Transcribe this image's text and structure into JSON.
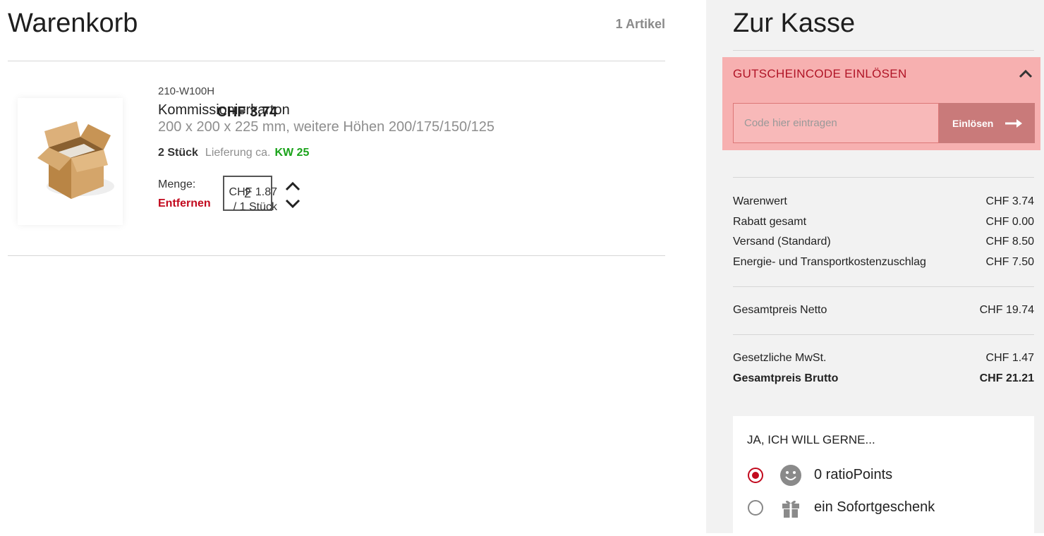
{
  "cart": {
    "title": "Warenkorb",
    "item_count": "1 Artikel",
    "item": {
      "sku": "210-W100H",
      "name": "Kommissionierkarton",
      "dimensions": "200 x 200 x 225 mm, weitere Höhen 200/175/150/125",
      "quantity_text": "2 Stück",
      "delivery_label": "Lieferung ca.",
      "delivery_week": "KW 25",
      "price": "CHF 3.74",
      "quantity_label": "Menge:",
      "remove_label": "Entfernen",
      "quantity_value": "2",
      "unit_price": "CHF 1.87",
      "unit_per": "/ 1 Stück"
    }
  },
  "checkout": {
    "title": "Zur Kasse",
    "coupon": {
      "title": "GUTSCHEINCODE EINLÖSEN",
      "placeholder": "Code hier eintragen",
      "button_label": "Einlösen"
    },
    "summary": [
      {
        "label": "Warenwert",
        "value": "CHF 3.74"
      },
      {
        "label": "Rabatt gesamt",
        "value": "CHF 0.00"
      },
      {
        "label": "Versand (Standard)",
        "value": "CHF 8.50"
      },
      {
        "label": "Energie- und Transportkostenzuschlag",
        "value": "CHF 7.50"
      }
    ],
    "net": {
      "label": "Gesamtpreis Netto",
      "value": "CHF 19.74"
    },
    "vat": {
      "label": "Gesetzliche MwSt.",
      "value": "CHF 1.47"
    },
    "gross": {
      "label": "Gesamtpreis Brutto",
      "value": "CHF 21.21"
    },
    "bonus": {
      "title": "JA, ICH WILL GERNE...",
      "options": [
        {
          "label": "0 ratioPoints",
          "icon": "smiley-icon",
          "selected": true
        },
        {
          "label": "ein Sofortgeschenk",
          "icon": "gift-icon",
          "selected": false
        }
      ]
    }
  },
  "colors": {
    "accent_red": "#c20a1e",
    "coupon_bg": "#f7b0b0",
    "delivery_green": "#1aa31a",
    "sidebar_bg": "#f2f2f2"
  }
}
